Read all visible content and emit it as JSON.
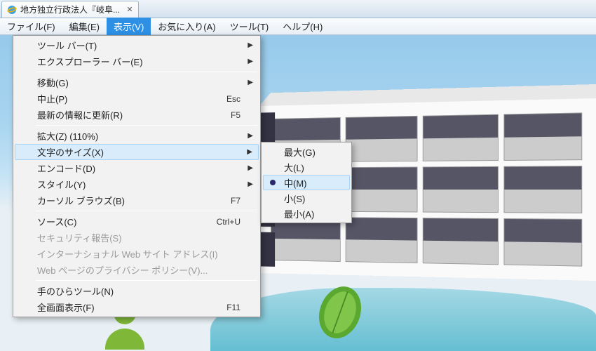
{
  "tab": {
    "title": "地方独立行政法人『岐阜..."
  },
  "menubar": {
    "items": [
      {
        "label": "ファイル(F)"
      },
      {
        "label": "編集(E)"
      },
      {
        "label": "表示(V)",
        "active": true
      },
      {
        "label": "お気に入り(A)"
      },
      {
        "label": "ツール(T)"
      },
      {
        "label": "ヘルプ(H)"
      }
    ]
  },
  "view_menu": {
    "groups": [
      [
        {
          "label": "ツール バー(T)",
          "submenu": true
        },
        {
          "label": "エクスプローラー バー(E)",
          "submenu": true
        }
      ],
      [
        {
          "label": "移動(G)",
          "submenu": true
        },
        {
          "label": "中止(P)",
          "accel": "Esc"
        },
        {
          "label": "最新の情報に更新(R)",
          "accel": "F5"
        }
      ],
      [
        {
          "label": "拡大(Z) (110%)",
          "submenu": true
        },
        {
          "label": "文字のサイズ(X)",
          "submenu": true,
          "hover": true
        },
        {
          "label": "エンコード(D)",
          "submenu": true
        },
        {
          "label": "スタイル(Y)",
          "submenu": true
        },
        {
          "label": "カーソル ブラウズ(B)",
          "accel": "F7"
        }
      ],
      [
        {
          "label": "ソース(C)",
          "accel": "Ctrl+U"
        },
        {
          "label": "セキュリティ報告(S)",
          "disabled": true
        },
        {
          "label": "インターナショナル Web サイト アドレス(I)",
          "disabled": true
        },
        {
          "label": "Web ページのプライバシー ポリシー(V)...",
          "disabled": true
        }
      ],
      [
        {
          "label": "手のひらツール(N)"
        },
        {
          "label": "全画面表示(F)",
          "accel": "F11"
        }
      ]
    ]
  },
  "textsize_submenu": {
    "items": [
      {
        "label": "最大(G)"
      },
      {
        "label": "大(L)"
      },
      {
        "label": "中(M)",
        "selected": true,
        "hover": true
      },
      {
        "label": "小(S)"
      },
      {
        "label": "最小(A)"
      }
    ]
  }
}
